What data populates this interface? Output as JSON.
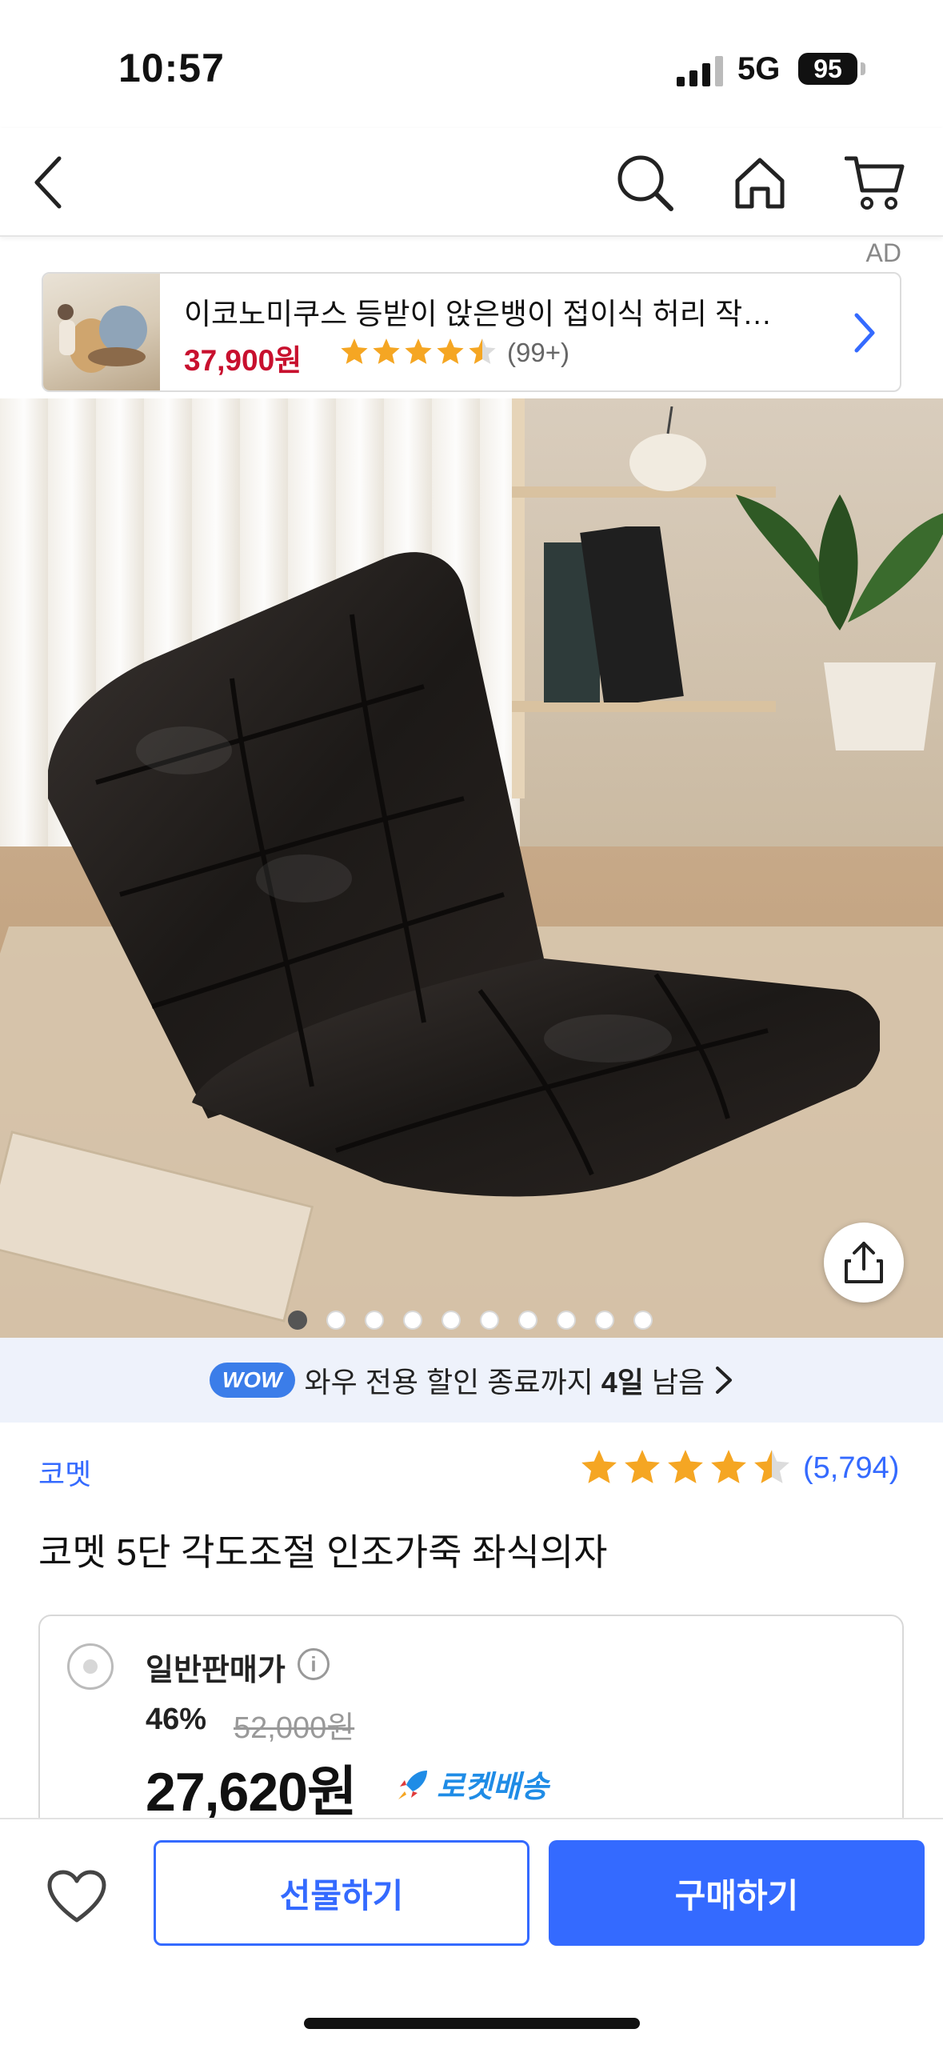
{
  "status_bar": {
    "time": "10:57",
    "network": "5G",
    "battery": "95"
  },
  "nav": {
    "back_icon": "chevron-left-icon",
    "search_icon": "search-icon",
    "home_icon": "home-icon",
    "cart_icon": "cart-icon"
  },
  "ad": {
    "label": "AD",
    "title": "이코노미쿠스 등받이 앉은뱅이 접이식 허리 작…",
    "price": "37,900원",
    "rating": 4.5,
    "review_count": "(99+)"
  },
  "gallery": {
    "total_images": 10,
    "current_index": 1
  },
  "wow_banner": {
    "badge": "WOW",
    "text_before": "와우 전용 할인 종료까지 ",
    "highlight": "4일",
    "text_after": " 남음"
  },
  "product": {
    "brand": "코멧",
    "rating": 4.5,
    "review_count": "(5,794)",
    "title": "코멧 5단 각도조절 인조가죽 좌식의자"
  },
  "price_option": {
    "label": "일반판매가",
    "info_glyph": "i",
    "discount": "46%",
    "original_price": "52,000원",
    "sale_price": "27,620원",
    "delivery": "로켓배송"
  },
  "bottom_bar": {
    "gift_label": "선물하기",
    "buy_label": "구매하기"
  },
  "colors": {
    "accent": "#346aff",
    "ad_price": "#c8102e",
    "star": "#f5a623",
    "rocket": "#1f8ce6"
  }
}
